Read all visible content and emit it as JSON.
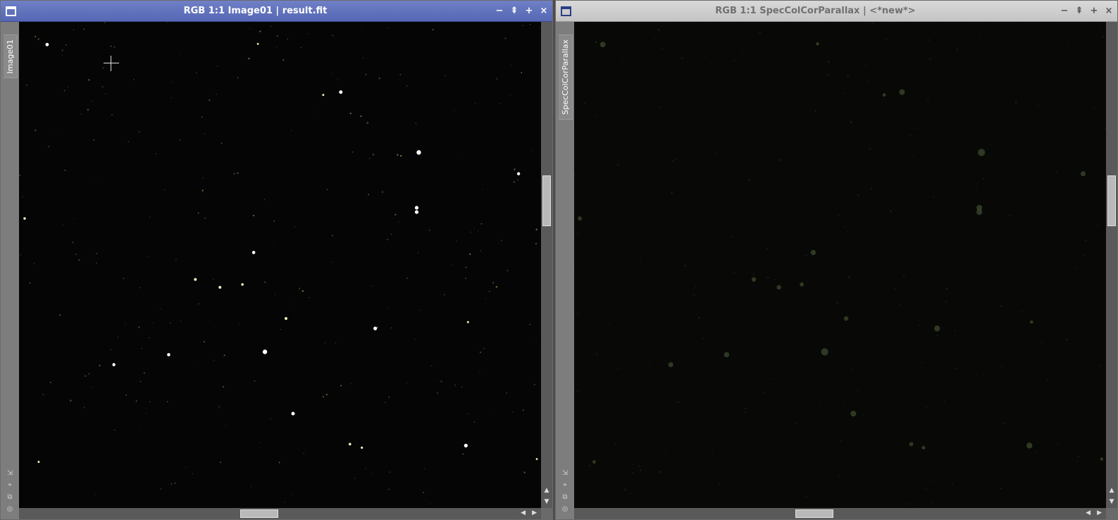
{
  "windows": [
    {
      "title": "RGB 1:1 Image01 | result.fit",
      "tab_label": "Image01",
      "active": true,
      "accent_color": "#5a6bbb",
      "controls": [
        "−",
        "⇞",
        "+",
        "×"
      ]
    },
    {
      "title": "RGB 1:1 SpecColCorParallax | <*new*>",
      "tab_label": "SpecColCorParallax",
      "active": false,
      "accent_color": "#cfcfcf",
      "controls": [
        "−",
        "⇞",
        "+",
        "×"
      ]
    }
  ],
  "icons": {
    "window": "window-icon",
    "minimize": "minimize-icon",
    "shade": "shade-icon",
    "maximize": "maximize-icon",
    "close": "close-icon",
    "side": [
      "resize-icon",
      "fit-icon",
      "clone-icon",
      "target-icon"
    ],
    "crosshair": "crosshair-cursor-icon"
  },
  "side_glyphs": [
    "⇲",
    "⌖",
    "⧉",
    "◎"
  ],
  "scroll_glyphs": {
    "up": "▲",
    "down": "▼",
    "left": "◀",
    "right": "▶"
  }
}
